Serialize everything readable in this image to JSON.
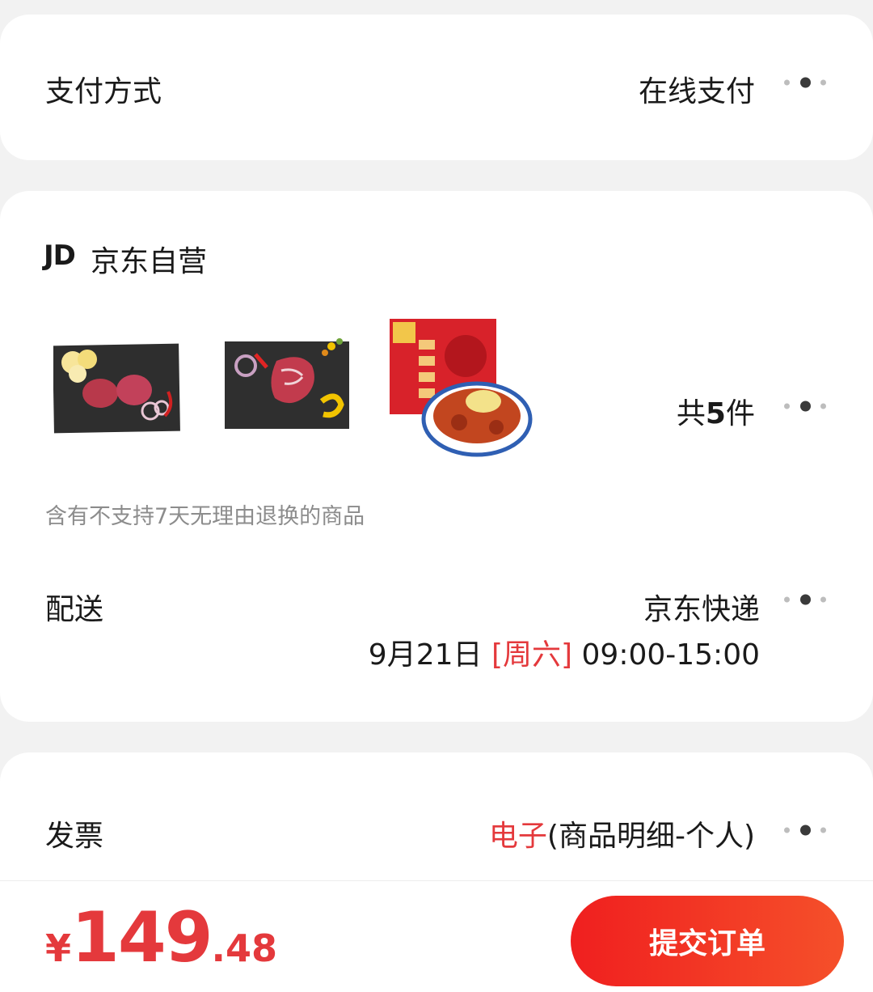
{
  "payment": {
    "label": "支付方式",
    "value": "在线支付",
    "more_icon": "more-dots-icon"
  },
  "shop": {
    "logo": "JD",
    "name": "京东自营",
    "products": [
      {
        "name": "product-thumb-beef-medallions"
      },
      {
        "name": "product-thumb-beef-steak"
      },
      {
        "name": "product-thumb-crayfish-box"
      }
    ],
    "count_prefix": "共",
    "count": "5",
    "count_suffix": "件",
    "notice": "含有不支持7天无理由退换的商品"
  },
  "delivery": {
    "label": "配送",
    "carrier": "京东快递",
    "date": "9月21日",
    "weekday": "[周六]",
    "time": "09:00-15:00"
  },
  "invoice": {
    "label": "发票",
    "type": "电子",
    "detail": "(商品明细-个人)"
  },
  "footer": {
    "currency": "¥",
    "price_int": "149",
    "price_dec": ".48",
    "submit_label": "提交订单"
  },
  "colors": {
    "accent": "#e4393c",
    "background": "#f2f2f2",
    "card": "#ffffff"
  }
}
